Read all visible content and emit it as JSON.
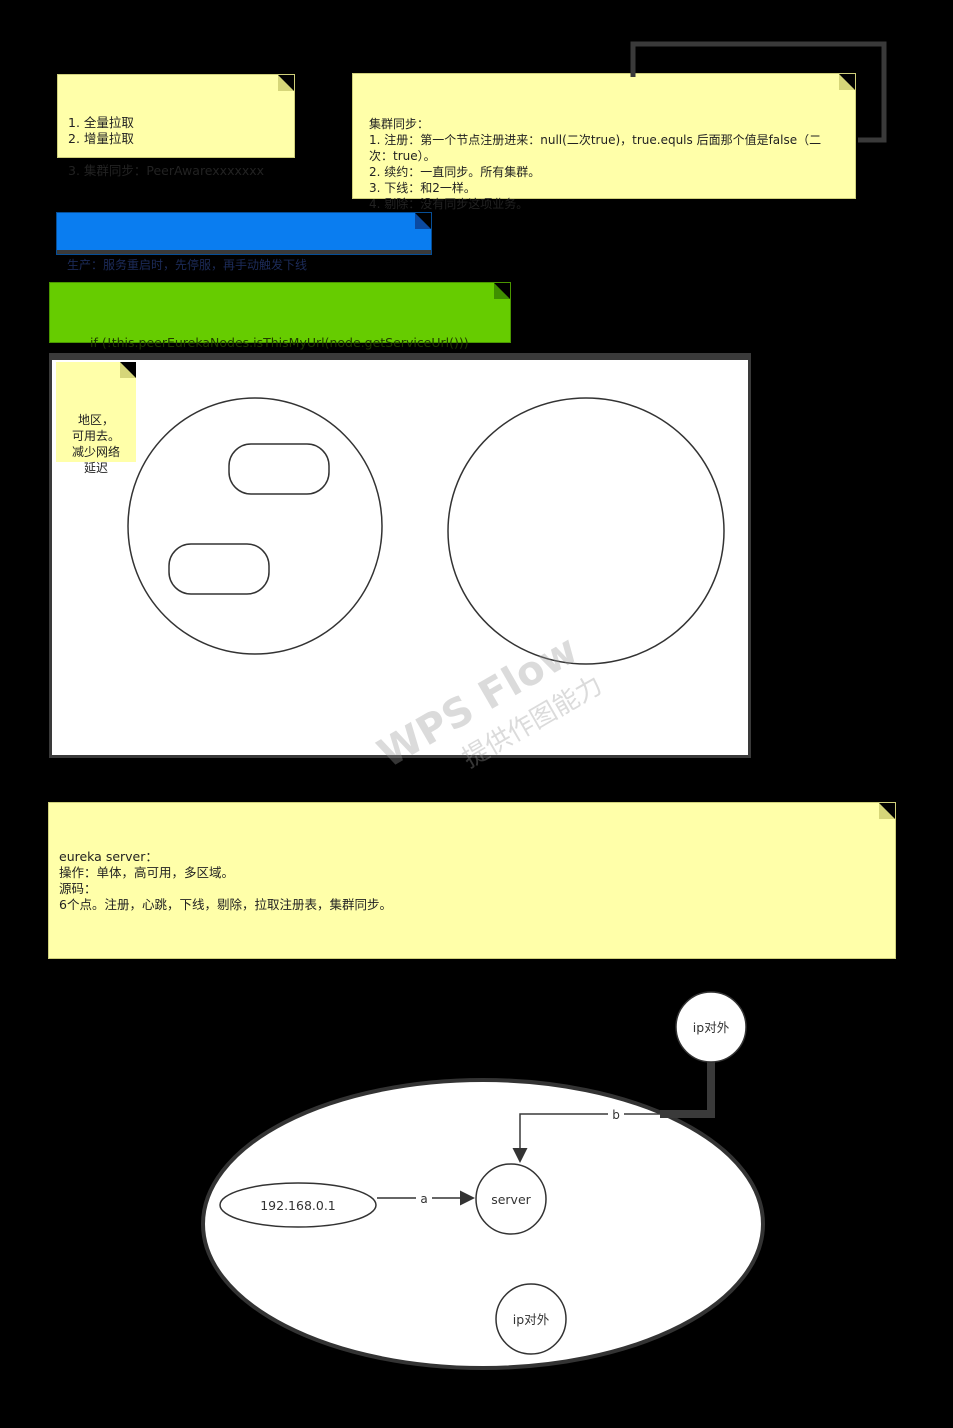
{
  "notes": {
    "sync_list": "1. 全量拉取\n2. 增量拉取\n\n3. 集群同步：PeerAwarexxxxxxx",
    "cluster_sync": "集群同步：\n1. 注册：第一个节点注册进来：null(二次true)，true.equls 后面那个值是false（二次：true）。\n2. 续约：一直同步。所有集群。\n3. 下线：和2一样。\n4. 剔除：没有同步这项业务。",
    "production": "生产：服务重启时，先停服，再手动触发下线",
    "code": "if (!this.peerEurekaNodes.isThisMyUrl(node.getServiceUrl()))",
    "region": "地区，\n可用去。\n减少网络\n延迟",
    "eureka": "eureka server：\n操作：单体，高可用，多区域。\n源码：\n6个点。注册，心跳，下线，剔除，拉取注册表，集群同步。"
  },
  "network": {
    "ip_node_outer": "ip对外",
    "ip_node_inner": "ip对外",
    "client_ip": "192.168.0.1",
    "server": "server",
    "edge_a": "a",
    "edge_b": "b"
  },
  "watermark": {
    "line1": "WPS Flow",
    "line2": "提供作图能力"
  },
  "colors": {
    "note_yellow": "#ffffa9",
    "note_blue": "#0a7df0",
    "note_green": "#66cc00",
    "canvas": "#000000"
  }
}
